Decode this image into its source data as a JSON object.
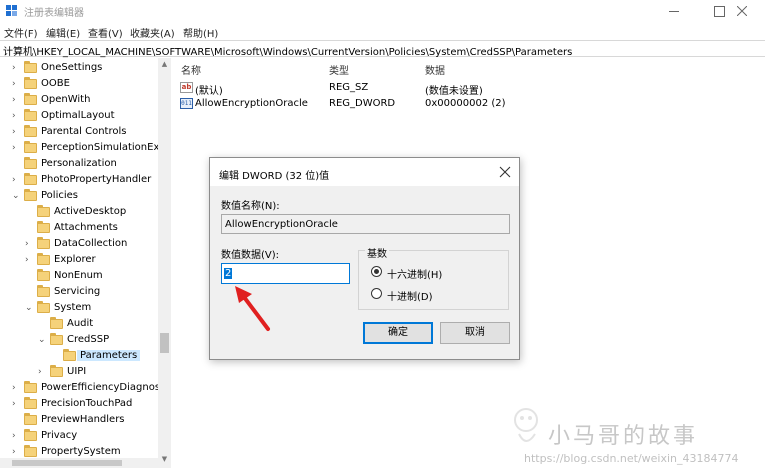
{
  "window": {
    "title": "注册表编辑器",
    "brand_color": "#1f6fd1"
  },
  "menu": [
    {
      "label": "文件(F)"
    },
    {
      "label": "编辑(E)"
    },
    {
      "label": "查看(V)"
    },
    {
      "label": "收藏夹(A)"
    },
    {
      "label": "帮助(H)"
    }
  ],
  "address": "计算机\\HKEY_LOCAL_MACHINE\\SOFTWARE\\Microsoft\\Windows\\CurrentVersion\\Policies\\System\\CredSSP\\Parameters",
  "tree": [
    {
      "label": "OneSettings",
      "expander": "collapsed"
    },
    {
      "label": "OOBE",
      "expander": "collapsed"
    },
    {
      "label": "OpenWith",
      "expander": "collapsed"
    },
    {
      "label": "OptimalLayout",
      "expander": "collapsed"
    },
    {
      "label": "Parental Controls",
      "expander": "collapsed"
    },
    {
      "label": "PerceptionSimulationEx",
      "expander": "collapsed"
    },
    {
      "label": "Personalization",
      "expander": "none"
    },
    {
      "label": "PhotoPropertyHandler",
      "expander": "collapsed"
    },
    {
      "label": "Policies",
      "expander": "expanded"
    },
    {
      "label": "ActiveDesktop",
      "expander": "none"
    },
    {
      "label": "Attachments",
      "expander": "none"
    },
    {
      "label": "DataCollection",
      "expander": "collapsed"
    },
    {
      "label": "Explorer",
      "expander": "collapsed"
    },
    {
      "label": "NonEnum",
      "expander": "none"
    },
    {
      "label": "Servicing",
      "expander": "none"
    },
    {
      "label": "System",
      "expander": "expanded"
    },
    {
      "label": "Audit",
      "expander": "none"
    },
    {
      "label": "CredSSP",
      "expander": "expanded"
    },
    {
      "label": "Parameters",
      "expander": "none",
      "selected": true
    },
    {
      "label": "UIPI",
      "expander": "collapsed"
    },
    {
      "label": "PowerEfficiencyDiagnos",
      "expander": "collapsed"
    },
    {
      "label": "PrecisionTouchPad",
      "expander": "collapsed"
    },
    {
      "label": "PreviewHandlers",
      "expander": "none"
    },
    {
      "label": "Privacy",
      "expander": "collapsed"
    },
    {
      "label": "PropertySystem",
      "expander": "collapsed"
    }
  ],
  "list": {
    "columns": {
      "name": "名称",
      "type": "类型",
      "data": "数据"
    },
    "rows": [
      {
        "icon": "string-value-icon",
        "name": "(默认)",
        "type": "REG_SZ",
        "data": "(数值未设置)"
      },
      {
        "icon": "dword-value-icon",
        "name": "AllowEncryptionOracle",
        "type": "REG_DWORD",
        "data": "0x00000002 (2)"
      }
    ]
  },
  "dialog": {
    "title": "编辑 DWORD (32 位)值",
    "name_label": "数值名称(N):",
    "name_value": "AllowEncryptionOracle",
    "data_label": "数值数据(V):",
    "data_value": "2",
    "base_label": "基数",
    "hex_label": "十六进制(H)",
    "dec_label": "十进制(D)",
    "hex_checked": true,
    "ok_label": "确定",
    "cancel_label": "取消",
    "accent_color": "#0078d7"
  },
  "annotation": {
    "arrow_color": "#e02020"
  },
  "watermark": {
    "text": "小马哥的故事",
    "url": "https://blog.csdn.net/weixin_43184774"
  }
}
